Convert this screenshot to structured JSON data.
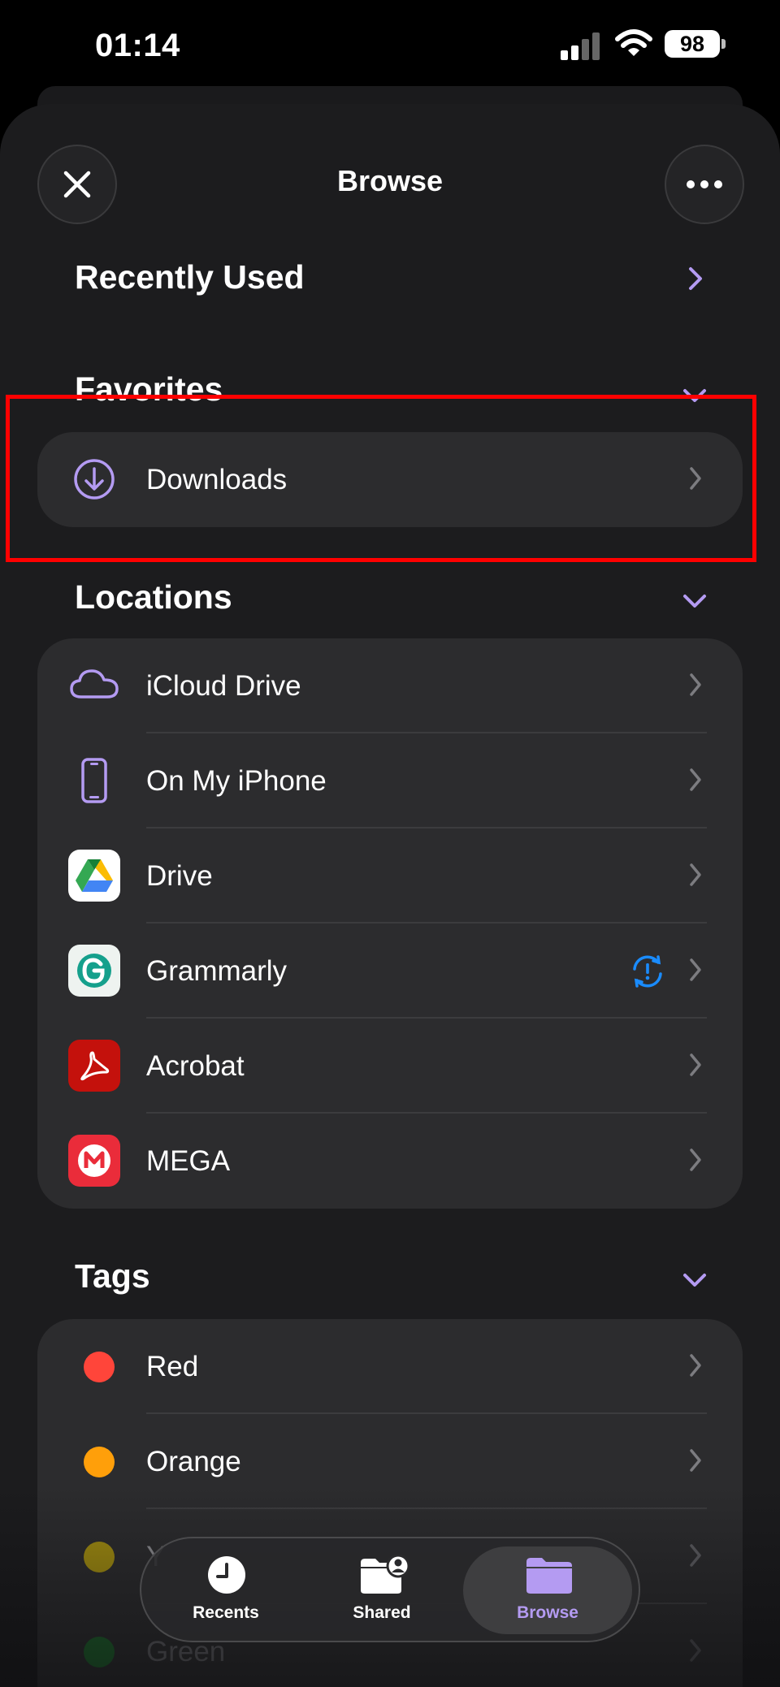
{
  "status": {
    "time": "01:14",
    "battery": "98"
  },
  "sheet": {
    "title": "Browse"
  },
  "recently_used": {
    "label": "Recently Used"
  },
  "favorites": {
    "header": "Favorites",
    "items": [
      {
        "label": "Downloads",
        "icon": "download-circle-icon"
      }
    ]
  },
  "locations": {
    "header": "Locations",
    "items": [
      {
        "label": "iCloud Drive",
        "icon": "icloud-icon"
      },
      {
        "label": "On My iPhone",
        "icon": "iphone-icon"
      },
      {
        "label": "Drive",
        "icon": "google-drive-icon"
      },
      {
        "label": "Grammarly",
        "icon": "grammarly-icon",
        "status_icon": "sync-alert-icon"
      },
      {
        "label": "Acrobat",
        "icon": "acrobat-icon"
      },
      {
        "label": "MEGA",
        "icon": "mega-icon"
      }
    ]
  },
  "tags": {
    "header": "Tags",
    "items": [
      {
        "label": "Red",
        "color": "#ff453a"
      },
      {
        "label": "Orange",
        "color": "#ff9f0a"
      },
      {
        "label": "Y",
        "color": "#9e8a12"
      },
      {
        "label": "Green",
        "color": "#1f5e2c"
      }
    ]
  },
  "tabbar": {
    "tabs": [
      {
        "label": "Recents",
        "icon": "clock-icon",
        "active": false
      },
      {
        "label": "Shared",
        "icon": "shared-folder-icon",
        "active": false
      },
      {
        "label": "Browse",
        "icon": "folder-icon",
        "active": true
      }
    ]
  },
  "colors": {
    "accent": "#b49bf2",
    "sheet": "#1c1c1e",
    "group": "#2c2c2e",
    "highlight": "#ff0000"
  }
}
